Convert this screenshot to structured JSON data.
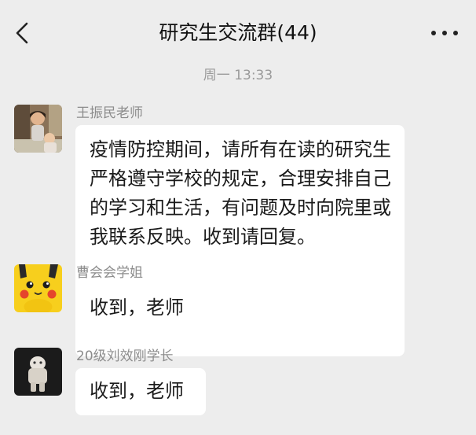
{
  "header": {
    "title": "研究生交流群(44)",
    "back_icon": "chevron-left-icon",
    "more_icon": "more-dots-icon"
  },
  "chat": {
    "timestamp": "周一 13:33",
    "messages": [
      {
        "sender": "王振民老师",
        "text": "疫情防控期间，请所有在读的研究生严格遵守学校的规定，合理安排自己的学习和生活，有问题及时向院里或我联系反映。收到请回复。",
        "avatar": "photo-avatar"
      },
      {
        "sender": "曹会会学姐",
        "text": "收到，老师",
        "avatar": "pikachu-avatar"
      },
      {
        "sender": "20级刘效刚学长",
        "text": "收到，老师",
        "avatar": "figure-avatar"
      }
    ]
  },
  "colors": {
    "background": "#ededed",
    "bubble": "#ffffff",
    "meta_text": "#8c8c8c",
    "avatar_yellow": "#f7cf1d"
  }
}
